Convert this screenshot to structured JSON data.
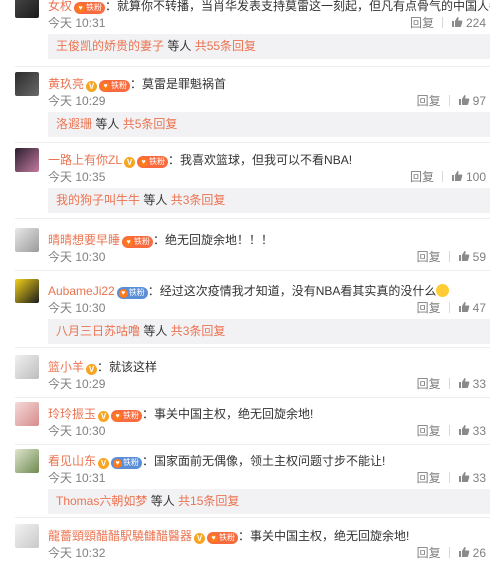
{
  "comments": [
    {
      "user": "女权",
      "has_badge": true,
      "badge": "铁粉",
      "sep": "：",
      "text": "就算你不转播，当肖华发表支持莫雷这一刻起，但凡有点骨气的中国人都不会看nba",
      "time": "今天 10:31",
      "reply_label": "回复",
      "likes": "224",
      "replies": {
        "name": "王俊凯的娇贵的妻子",
        "mid": " 等人 ",
        "count": "共55条回复"
      }
    },
    {
      "user": "黄玖亮",
      "has_v": true,
      "has_badge": true,
      "badge": "铁粉",
      "sep": "：",
      "text": "莫雷是罪魁祸首",
      "time": "今天 10:29",
      "reply_label": "回复",
      "likes": "97",
      "replies": {
        "name": "洛遐珊",
        "mid": " 等人 ",
        "count": "共5条回复"
      }
    },
    {
      "user": "一路上有你ZL",
      "has_v": true,
      "has_badge": true,
      "badge": "铁粉",
      "sep": "：",
      "text": "我喜欢篮球，但我可以不看NBA!",
      "time": "今天 10:35",
      "reply_label": "回复",
      "likes": "100",
      "replies": {
        "name": "我的狗子叫牛牛",
        "mid": " 等人 ",
        "count": "共3条回复"
      }
    },
    {
      "user": "晴晴想要早睡",
      "has_badge": true,
      "badge": "铁粉",
      "sep": "：",
      "text": "绝无回旋余地！！！",
      "time": "今天 10:30",
      "reply_label": "回复",
      "likes": "59"
    },
    {
      "user": "AubameJi22",
      "has_badge": true,
      "badge": "铁粉",
      "badge_color": "blue",
      "sep": "：",
      "text": "经过这次疫情我才知道，没有NBA看其实真的没什么",
      "has_emoji": true,
      "time": "今天 10:30",
      "reply_label": "回复",
      "likes": "47",
      "replies": {
        "name": "八月三日苏咕噜",
        "mid": " 等人 ",
        "count": "共3条回复"
      }
    },
    {
      "user": "篮小羊",
      "has_v": true,
      "sep": "：",
      "text": "就该这样",
      "time": "今天 10:29",
      "reply_label": "回复",
      "likes": "33"
    },
    {
      "user": "玲玲振玉",
      "has_v": true,
      "has_badge": true,
      "badge": "铁粉",
      "sep": "：",
      "text": "事关中国主权，绝无回旋余地!",
      "time": "今天 10:30",
      "reply_label": "回复",
      "likes": "33"
    },
    {
      "user": "看见山东",
      "has_v": true,
      "has_badge": true,
      "badge": "铁粉",
      "badge_color": "blue",
      "sep": "：",
      "text": "国家面前无偶像，领土主权问题寸步不能让!",
      "time": "今天 10:31",
      "reply_label": "回复",
      "likes": "33",
      "replies": {
        "name": "Thomas六朝如梦",
        "mid": " 等人 ",
        "count": "共15条回复"
      }
    },
    {
      "user": "龍薔頸頸醋醋駅驍讎醋醫器",
      "has_v": true,
      "has_badge": true,
      "badge": "铁粉",
      "sep": "：",
      "text": "事关中国主权，绝无回旋余地!",
      "time": "今天 10:32",
      "reply_label": "回复",
      "likes": "26"
    }
  ],
  "avatars": [
    {
      "name": "avatar-nvquan",
      "colors": [
        "#4a4a4a",
        "#1a1a1a"
      ]
    },
    {
      "name": "avatar-huangjiuliang",
      "colors": [
        "#2b2b2b",
        "#6a6a6a"
      ]
    },
    {
      "name": "avatar-yilushang",
      "colors": [
        "#2a1f2e",
        "#c47aa0"
      ]
    },
    {
      "name": "avatar-qingqing",
      "colors": [
        "#e8e8e8",
        "#9a9a9a"
      ]
    },
    {
      "name": "avatar-aubame",
      "colors": [
        "#f3d21a",
        "#1b1b1b"
      ]
    },
    {
      "name": "avatar-lanxiaoyang",
      "colors": [
        "#f0f0f0",
        "#bdbdbd"
      ]
    },
    {
      "name": "avatar-lingling",
      "colors": [
        "#f4dada",
        "#d78b8b"
      ]
    },
    {
      "name": "avatar-kanjianshandong",
      "colors": [
        "#dfe6cf",
        "#6f8a4f"
      ]
    },
    {
      "name": "avatar-longqiang",
      "colors": [
        "#f2f2f2",
        "#c9c9c9"
      ]
    }
  ],
  "colors": {
    "username": "#eb7350",
    "time": "#808080",
    "reply_bg": "#f2f2f5",
    "v_mark": "#f7a623"
  }
}
